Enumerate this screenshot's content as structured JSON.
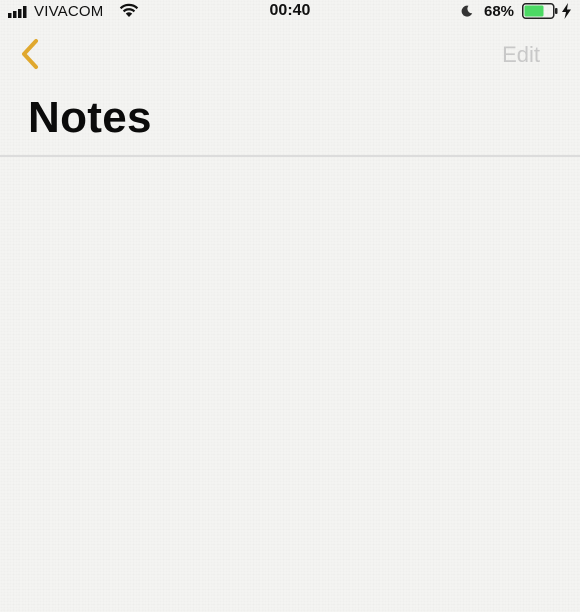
{
  "status_bar": {
    "carrier": "VIVACOM",
    "time": "00:40",
    "battery_percent": "68%",
    "battery_level": 0.68,
    "battery_color": "#4cd964",
    "icons": [
      "signal-icon",
      "wifi-icon",
      "moon-icon",
      "battery-icon",
      "charging-bolt-icon"
    ]
  },
  "nav": {
    "back_icon": "chevron-left-icon",
    "edit_label": "Edit",
    "accent_color": "#e0a82e"
  },
  "page": {
    "title": "Notes"
  }
}
